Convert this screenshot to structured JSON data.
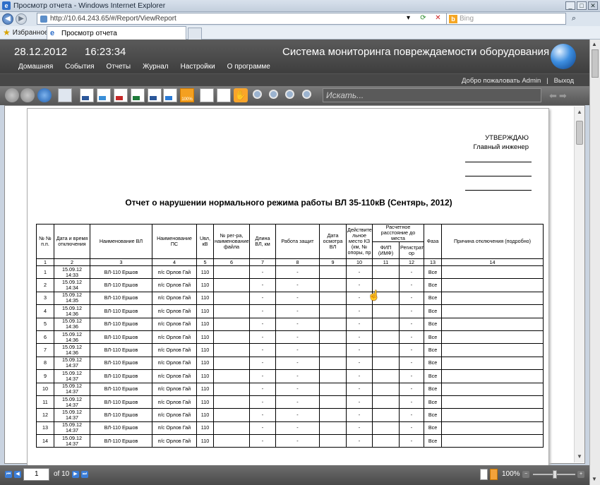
{
  "window": {
    "title": "Просмотр отчета - Windows Internet Explorer",
    "url": "http://10.64.243.65/#/Report/ViewReport",
    "search_placeholder": "Bing",
    "favorites_label": "Избранное",
    "tab_label": "Просмотр отчета"
  },
  "header": {
    "date": "28.12.2012",
    "time": "16:23:34",
    "title": "Система мониторинга повреждаемости оборудования",
    "menu": [
      "Домашняя",
      "События",
      "Отчеты",
      "Журнал",
      "Настройки",
      "О программе"
    ],
    "welcome": "Добро пожаловать Admin",
    "separator": "|",
    "logout": "Выход"
  },
  "toolbar": {
    "search_placeholder": "Искать...",
    "zoom_badge": "100%",
    "icons": [
      "back-icon",
      "forward-icon",
      "refresh-icon",
      "print-icon",
      "export-word-icon",
      "export-xps-icon",
      "export-pdf-icon",
      "export-excel-icon",
      "export-html-icon",
      "zoom-100-icon",
      "single-page-icon",
      "two-page-icon",
      "hand-tool-icon",
      "zoom-out-icon",
      "zoom-in-icon",
      "zoom-fit-icon",
      "zoom-width-icon"
    ]
  },
  "report": {
    "approve": "УТВЕРЖДАЮ",
    "approve_role": "Главный инженер",
    "title": "Отчет о нарушении нормального режима работы ВЛ 35-110кВ (Сентярь, 2012)",
    "headers": {
      "num": "№ № п.п.",
      "datetime": "Дата и время отключения",
      "line": "Наименование ВЛ",
      "substation": "Наименование ПС",
      "voltage": "Uвл, кВ",
      "recorder": "№ рег-ра, наименование файла",
      "length": "Длина ВЛ, км",
      "protection": "Работа защит",
      "inspection": "Дата осмотра ВЛ",
      "fault_location": "Действите льное место КЗ (км, № опоры, пр",
      "calc_distance": "Расчетное расстояние до места",
      "fip": "ФИП (ИМФ)",
      "registrar": "Регистрат ор",
      "phase": "Фаза",
      "reason": "Причина отключения (подробно)"
    },
    "column_numbers": [
      "1",
      "2",
      "3",
      "4",
      "5",
      "6",
      "7",
      "8",
      "9",
      "10",
      "11",
      "12",
      "13",
      "14"
    ],
    "rows": [
      {
        "n": "1",
        "date": "15.09.12",
        "time": "14:33",
        "line": "ВЛ-110 Ершов",
        "ps": "п/с Орлов Гай",
        "u": "110",
        "len": "-",
        "prot": "-",
        "fault": "-",
        "reg": "-",
        "phase": "Все"
      },
      {
        "n": "2",
        "date": "15.09.12",
        "time": "14:34",
        "line": "ВЛ-110 Ершов",
        "ps": "п/с Орлов Гай",
        "u": "110",
        "len": "-",
        "prot": "-",
        "fault": "-",
        "reg": "-",
        "phase": "Все"
      },
      {
        "n": "3",
        "date": "15.09.12",
        "time": "14:35",
        "line": "ВЛ-110 Ершов",
        "ps": "п/с Орлов Гай",
        "u": "110",
        "len": "-",
        "prot": "-",
        "fault": "-",
        "reg": "-",
        "phase": "Все"
      },
      {
        "n": "4",
        "date": "15.09.12",
        "time": "14:36",
        "line": "ВЛ-110 Ершов",
        "ps": "п/с Орлов Гай",
        "u": "110",
        "len": "-",
        "prot": "-",
        "fault": "-",
        "reg": "-",
        "phase": "Все"
      },
      {
        "n": "5",
        "date": "15.09.12",
        "time": "14:36",
        "line": "ВЛ-110 Ершов",
        "ps": "п/с Орлов Гай",
        "u": "110",
        "len": "-",
        "prot": "-",
        "fault": "-",
        "reg": "-",
        "phase": "Все"
      },
      {
        "n": "6",
        "date": "15.09.12",
        "time": "14:36",
        "line": "ВЛ-110 Ершов",
        "ps": "п/с Орлов Гай",
        "u": "110",
        "len": "-",
        "prot": "-",
        "fault": "-",
        "reg": "-",
        "phase": "Все"
      },
      {
        "n": "7",
        "date": "15.09.12",
        "time": "14:36",
        "line": "ВЛ-110 Ершов",
        "ps": "п/с Орлов Гай",
        "u": "110",
        "len": "-",
        "prot": "-",
        "fault": "-",
        "reg": "-",
        "phase": "Все"
      },
      {
        "n": "8",
        "date": "15.09.12",
        "time": "14:37",
        "line": "ВЛ-110 Ершов",
        "ps": "п/с Орлов Гай",
        "u": "110",
        "len": "-",
        "prot": "-",
        "fault": "-",
        "reg": "-",
        "phase": "Все"
      },
      {
        "n": "9",
        "date": "15.09.12",
        "time": "14:37",
        "line": "ВЛ-110 Ершов",
        "ps": "п/с Орлов Гай",
        "u": "110",
        "len": "-",
        "prot": "-",
        "fault": "-",
        "reg": "-",
        "phase": "Все"
      },
      {
        "n": "10",
        "date": "15.09.12",
        "time": "14:37",
        "line": "ВЛ-110 Ершов",
        "ps": "п/с Орлов Гай",
        "u": "110",
        "len": "-",
        "prot": "-",
        "fault": "-",
        "reg": "-",
        "phase": "Все"
      },
      {
        "n": "11",
        "date": "15.09.12",
        "time": "14:37",
        "line": "ВЛ-110 Ершов",
        "ps": "п/с Орлов Гай",
        "u": "110",
        "len": "-",
        "prot": "-",
        "fault": "-",
        "reg": "-",
        "phase": "Все"
      },
      {
        "n": "12",
        "date": "15.09.12",
        "time": "14:37",
        "line": "ВЛ-110 Ершов",
        "ps": "п/с Орлов Гай",
        "u": "110",
        "len": "-",
        "prot": "-",
        "fault": "-",
        "reg": "-",
        "phase": "Все"
      },
      {
        "n": "13",
        "date": "15.09.12",
        "time": "14:37",
        "line": "ВЛ-110 Ершов",
        "ps": "п/с Орлов Гай",
        "u": "110",
        "len": "-",
        "prot": "-",
        "fault": "-",
        "reg": "-",
        "phase": "Все"
      },
      {
        "n": "14",
        "date": "15.09.12",
        "time": "14:37",
        "line": "ВЛ-110 Ершов",
        "ps": "п/с Орлов Гай",
        "u": "110",
        "len": "-",
        "prot": "-",
        "fault": "-",
        "reg": "-",
        "phase": "Все"
      }
    ]
  },
  "pager": {
    "current_page": "1",
    "of_label": "of 10",
    "zoom": "100%"
  },
  "colors": {
    "app_header": "#474747",
    "accent_orange": "#f4a020"
  }
}
